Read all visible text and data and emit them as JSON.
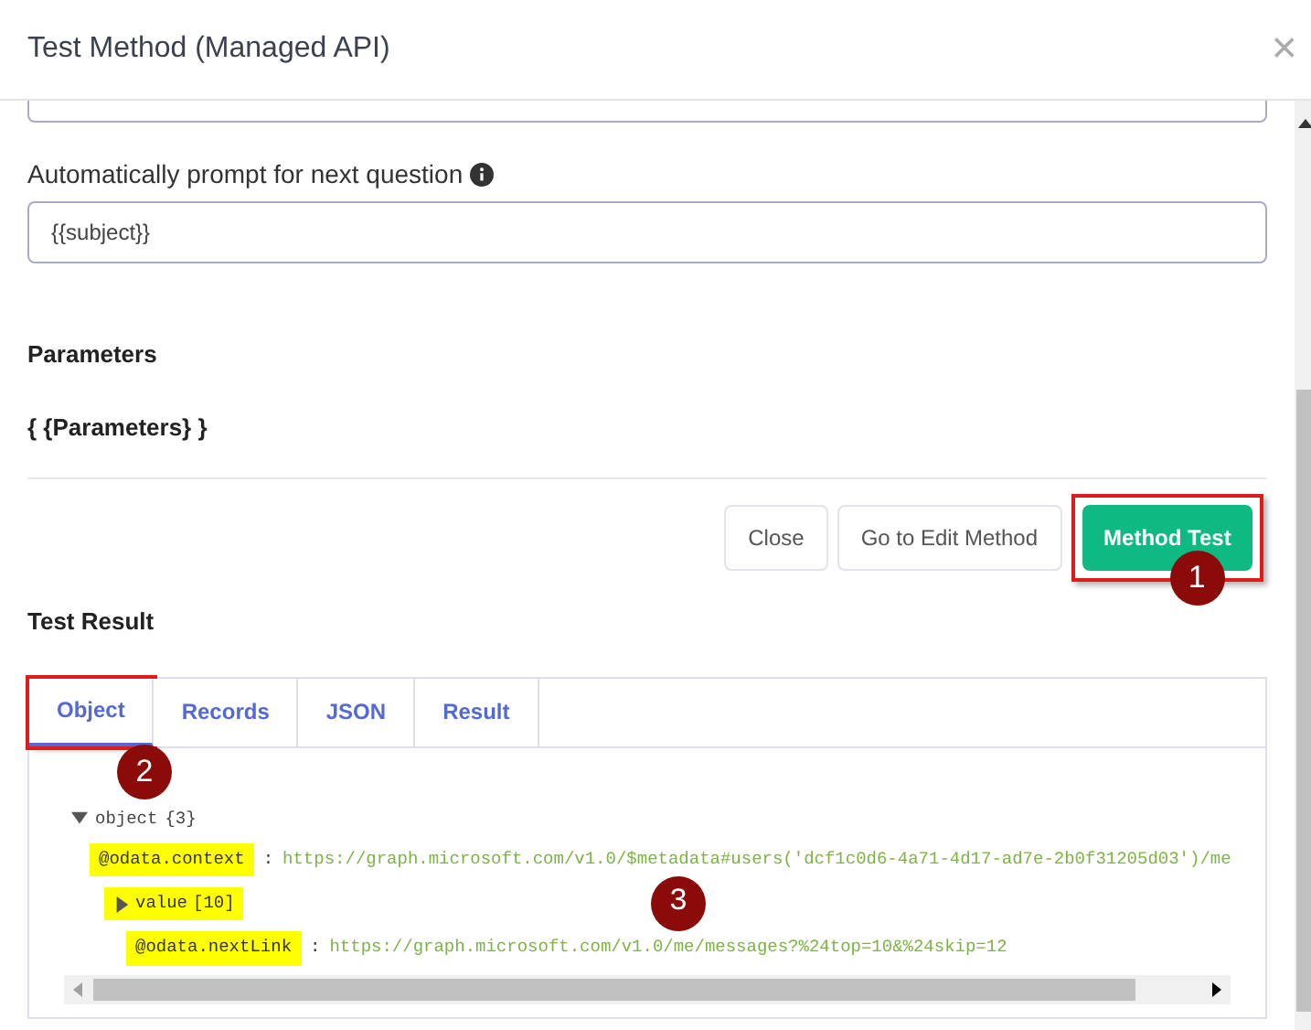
{
  "window": {
    "title": "Test Method (Managed API)",
    "close": "×"
  },
  "prompt_field": {
    "label": "Automatically prompt for next question",
    "value": "{{subject}}"
  },
  "parameters": {
    "heading": "Parameters",
    "value": "{ {Parameters} }"
  },
  "buttons": [
    {
      "label": "Close",
      "kind": "secondary",
      "highlighted": false
    },
    {
      "label": "Go to Edit Method",
      "kind": "secondary",
      "highlighted": false
    },
    {
      "label": "Method Test",
      "kind": "primary",
      "highlighted": true,
      "callout": "1"
    }
  ],
  "test_result": {
    "heading": "Test Result",
    "tabs": [
      {
        "label": "Object",
        "selected": true,
        "highlighted": true,
        "callout": "2"
      },
      {
        "label": "Records",
        "selected": false,
        "highlighted": false
      },
      {
        "label": "JSON",
        "selected": false,
        "highlighted": false
      },
      {
        "label": "Result",
        "selected": false,
        "highlighted": false
      }
    ],
    "tree": {
      "separator": ":",
      "label": "object",
      "count": "{3}",
      "expanded": true,
      "callout": "3",
      "children": [
        {
          "kind": "leaf",
          "key": "@odata.context",
          "value": "https://graph.microsoft.com/v1.0/$metadata#users('dcf1c0d6-4a71-4d17-ad7e-2b0f31205d03')/me",
          "highlighted": true
        },
        {
          "kind": "branch",
          "key": "value",
          "count": "[10]",
          "expanded": false,
          "highlighted": true
        },
        {
          "kind": "leaf",
          "key": "@odata.nextLink",
          "value": "https://graph.microsoft.com/v1.0/me/messages?%24top=10&%24skip=12",
          "highlighted": true
        }
      ]
    }
  }
}
